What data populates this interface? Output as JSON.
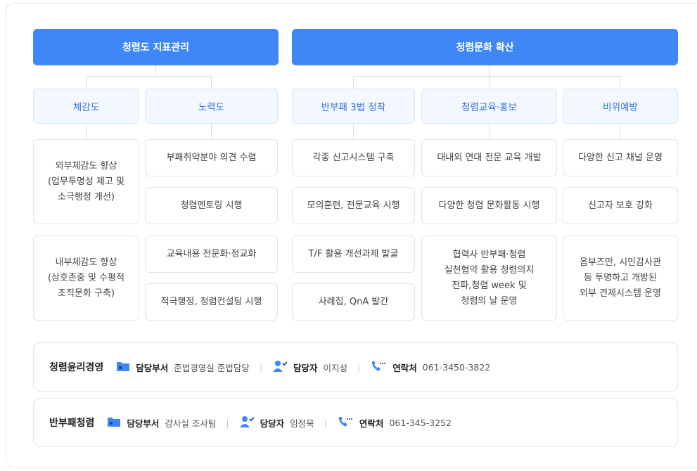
{
  "headers": {
    "left": "청렴도 지표관리",
    "right": "청렴문화 확산"
  },
  "columns": [
    {
      "title": "체감도",
      "items": [
        "외부체감도 향상\n(업무투명성 제고 및\n소극행정 개선)",
        "내부체감도 향상\n(상호존중 및 수평적\n조직문화 구축)"
      ]
    },
    {
      "title": "노력도",
      "items": [
        "부패취약분야 의견 수렴",
        "청렴멘토링 시행",
        "교육내용 전문화·정교화",
        "적극행정, 청렴컨설팅 시행"
      ]
    },
    {
      "title": "반부패 3법 정착",
      "items": [
        "각종 신고시스템 구축",
        "모의훈련, 전문교육 시행",
        "T/F 활용 개선과제 발굴",
        "사례집, QnA 발간"
      ]
    },
    {
      "title": "청렴교육·홍보",
      "items": [
        "대내외 연대 전문 교육 개발",
        "다양한 청렴 문화활동 시행",
        "협력사 반부패·청렴\n실천협약 활용 청렴의지\n전파,청렴 week 및\n청렴의 날 운영"
      ]
    },
    {
      "title": "비위예방",
      "items": [
        "다양한 신고 채널 운영",
        "신고자 보호 강화",
        "옴부즈만, 시민감사관\n등 투명하고 개방된\n외부 견제시스템 운영"
      ]
    }
  ],
  "contacts": [
    {
      "title": "청렴윤리경영",
      "dept_label": "담당부서",
      "dept": "준법경영실 준법담당",
      "person_label": "담당자",
      "person": "이지성",
      "phone_label": "연락처",
      "phone": "061-3450-3822",
      "sep": "|"
    },
    {
      "title": "반부패청렴",
      "dept_label": "담당부서",
      "dept": "감사실 조사팀",
      "person_label": "담당자",
      "person": "임정묵",
      "phone_label": "연락처",
      "phone": "061-345-3252",
      "sep": "|"
    }
  ],
  "colors": {
    "header": "#3f86f6",
    "sub_bg": "#f3f8fe",
    "sub_text": "#3575e0",
    "icon": "#3f86f6"
  },
  "icons": {
    "dept": "folder-icon",
    "person": "person-check-icon",
    "phone": "phone-icon"
  }
}
